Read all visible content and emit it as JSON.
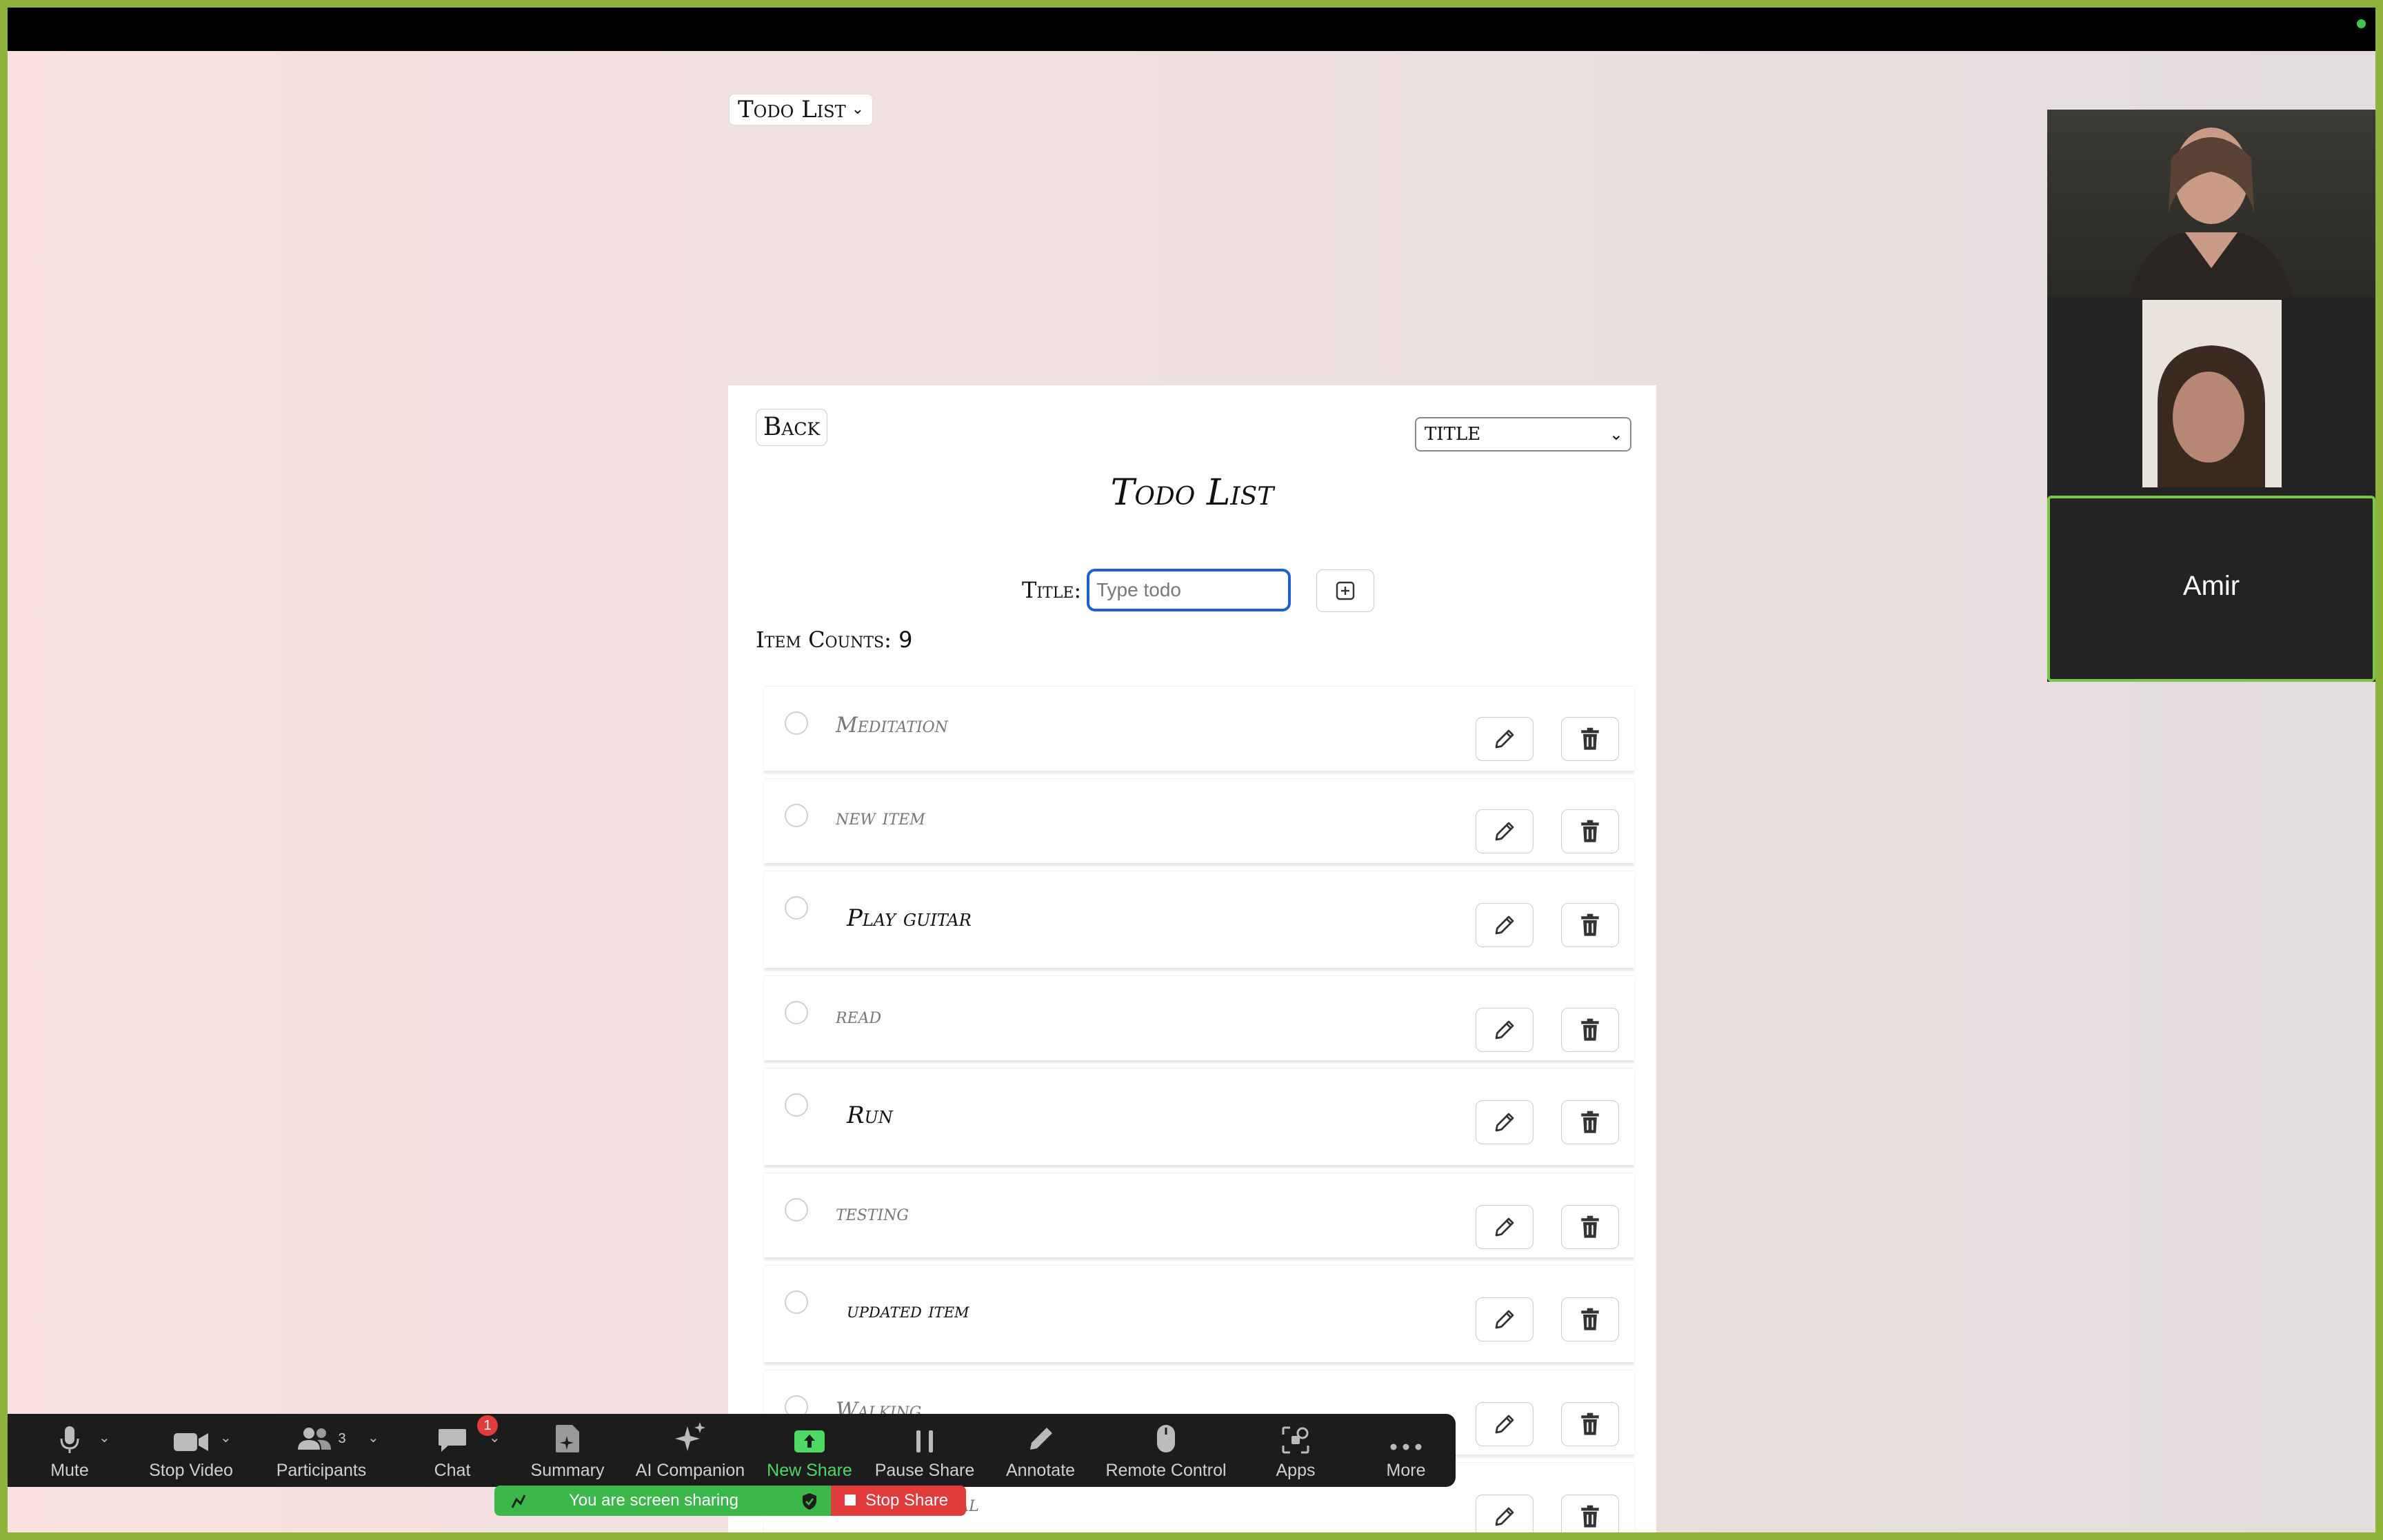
{
  "top_select": {
    "label": "Todo List"
  },
  "card": {
    "back_label": "Back",
    "sort_value": "TITLE",
    "title": "Todo List",
    "title_label": "Title:",
    "input_placeholder": "Type todo",
    "count_label": "Item Counts:",
    "count_value": "9"
  },
  "todos": [
    {
      "text": "Meditation",
      "state": "done"
    },
    {
      "text": "new item",
      "state": "done"
    },
    {
      "text": "Play guitar",
      "state": "active"
    },
    {
      "text": "read",
      "state": "done"
    },
    {
      "text": "Run",
      "state": "active"
    },
    {
      "text": "testing",
      "state": "done"
    },
    {
      "text": "updated item",
      "state": "active"
    },
    {
      "text": "Walking",
      "state": "done"
    },
    {
      "text": "nal",
      "state": "done"
    }
  ],
  "video": {
    "participant_name": "Amir"
  },
  "toolbar": {
    "mute": "Mute",
    "stop_video": "Stop Video",
    "participants": "Participants",
    "participants_count": "3",
    "chat": "Chat",
    "chat_badge": "1",
    "summary": "Summary",
    "ai_companion": "AI Companion",
    "new_share": "New Share",
    "pause_share": "Pause Share",
    "annotate": "Annotate",
    "remote_control": "Remote Control",
    "apps": "Apps",
    "more": "More"
  },
  "share_bar": {
    "status": "You are screen sharing",
    "stop": "Stop Share"
  },
  "colors": {
    "frame_border": "#8db33a",
    "input_focus": "#1f5fd1",
    "share_green": "#3cb84a",
    "stop_red": "#e23b3b",
    "active_speaker": "#7ac943"
  }
}
